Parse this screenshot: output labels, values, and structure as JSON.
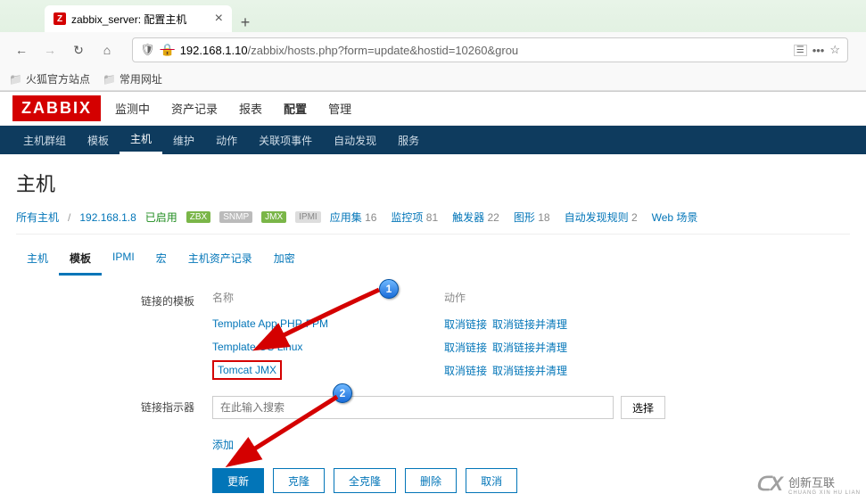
{
  "browser": {
    "tab_title": "zabbix_server: 配置主机",
    "url_display_prefix": "192.168.1.10",
    "url_display_path": "/zabbix/hosts.php?form=update&hostid=10260&grou",
    "bookmarks": [
      {
        "label": "火狐官方站点"
      },
      {
        "label": "常用网址"
      }
    ]
  },
  "header": {
    "logo": "ZABBIX",
    "menu": [
      "监测中",
      "资产记录",
      "报表",
      "配置",
      "管理"
    ],
    "active_menu_index": 3,
    "submenu": [
      "主机群组",
      "模板",
      "主机",
      "维护",
      "动作",
      "关联项事件",
      "自动发现",
      "服务"
    ],
    "active_submenu_index": 2
  },
  "page": {
    "title": "主机",
    "breadcrumb": {
      "all_hosts": "所有主机",
      "host_ip": "192.168.1.8",
      "status": "已启用"
    },
    "badges": [
      "ZBX",
      "SNMP",
      "JMX",
      "IPMI"
    ],
    "counts": [
      {
        "label": "应用集",
        "num": "16"
      },
      {
        "label": "监控项",
        "num": "81"
      },
      {
        "label": "触发器",
        "num": "22"
      },
      {
        "label": "图形",
        "num": "18"
      },
      {
        "label": "自动发现规则",
        "num": "2"
      },
      {
        "label": "Web 场景",
        "num": ""
      }
    ],
    "tabs": [
      "主机",
      "模板",
      "IPMI",
      "宏",
      "主机资产记录",
      "加密"
    ],
    "active_tab_index": 1
  },
  "form": {
    "linked_templates_label": "链接的模板",
    "col_name": "名称",
    "col_action": "动作",
    "templates": [
      {
        "name": "Template App PHP-FPM",
        "unlink": "取消链接",
        "clear": "取消链接并清理"
      },
      {
        "name": "Template OS Linux",
        "unlink": "取消链接",
        "clear": "取消链接并清理"
      },
      {
        "name": "Tomcat JMX",
        "unlink": "取消链接",
        "clear": "取消链接并清理"
      }
    ],
    "link_indicator_label": "链接指示器",
    "search_placeholder": "在此输入搜索",
    "select_button": "选择",
    "add_link": "添加",
    "buttons": {
      "update": "更新",
      "clone": "克隆",
      "full_clone": "全克隆",
      "delete": "删除",
      "cancel": "取消"
    }
  },
  "watermark": {
    "cn": "创新互联",
    "py": "CHUANG XIN HU LIAN"
  }
}
